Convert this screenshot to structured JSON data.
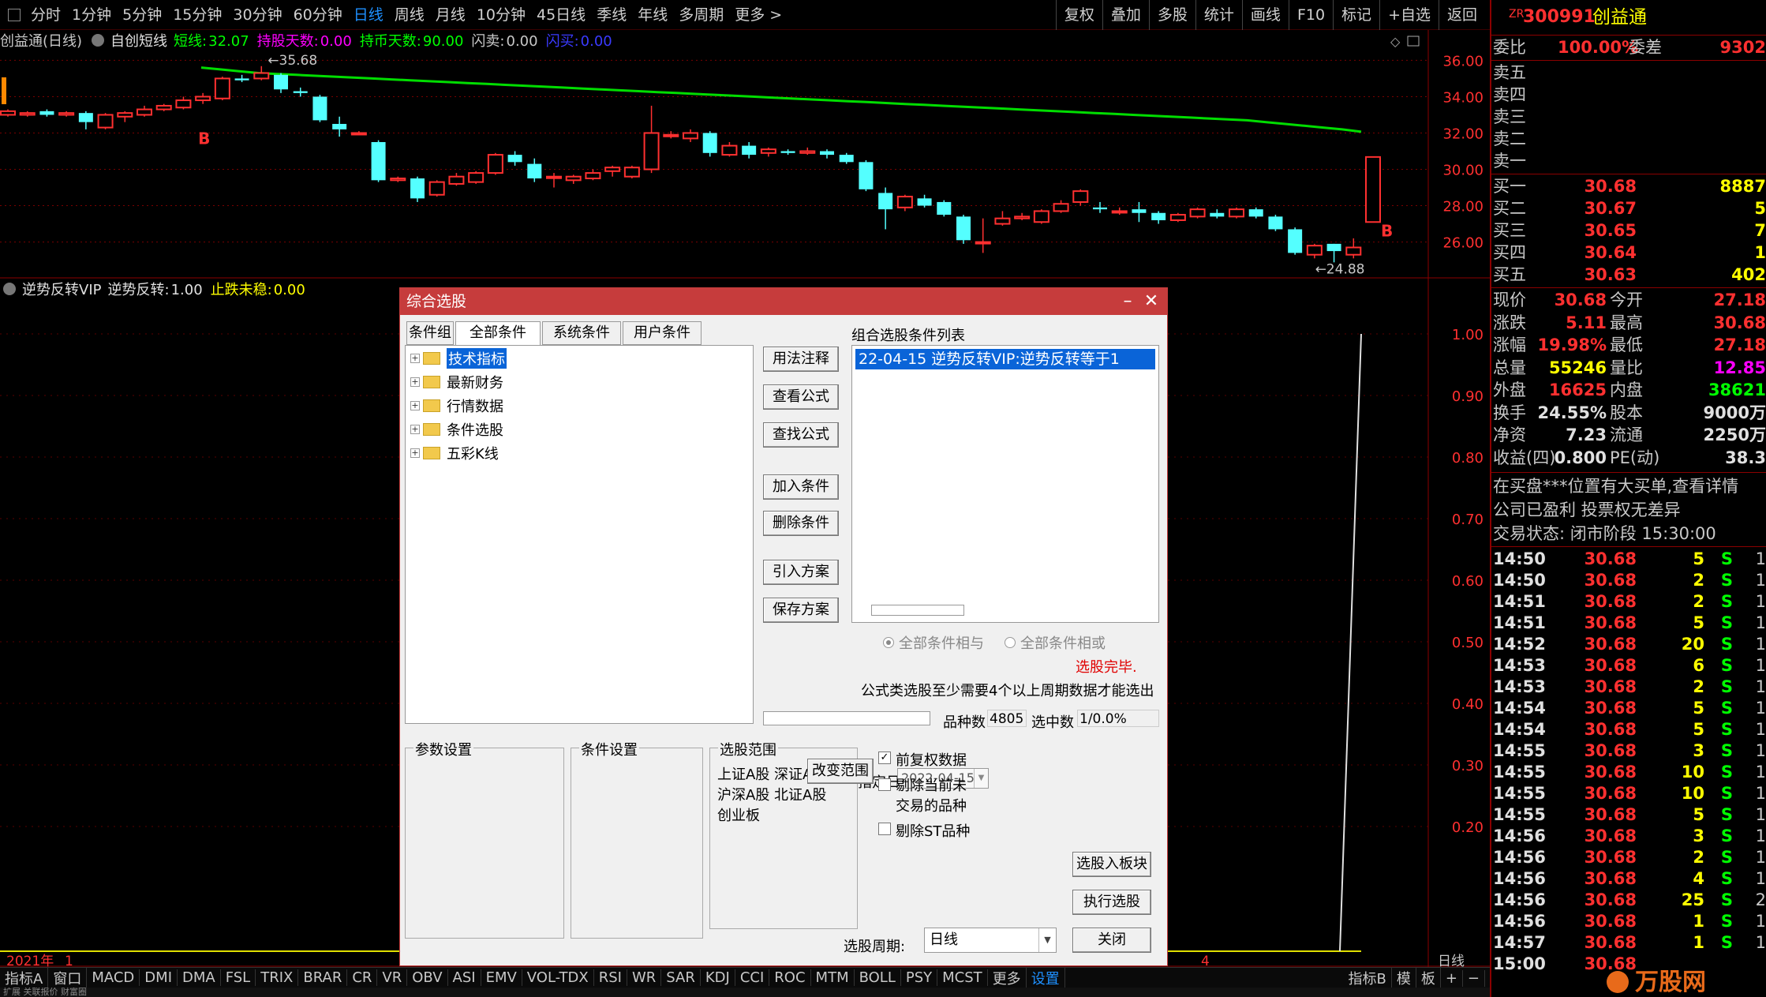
{
  "toolbar": {
    "left": [
      "分时",
      "1分钟",
      "5分钟",
      "15分钟",
      "30分钟",
      "60分钟",
      "日线",
      "周线",
      "月线",
      "10分钟",
      "45日线",
      "季线",
      "年线",
      "多周期",
      "更多 >"
    ],
    "active": "日线",
    "right": [
      "复权",
      "叠加",
      "多股",
      "统计",
      "画线",
      "F10",
      "标记",
      "+自选",
      "返回"
    ]
  },
  "kline_header": {
    "title": "创益通(日线)",
    "indicator": "自创短线",
    "items": [
      {
        "label": "短线:",
        "value": "32.07",
        "color": "#00ff00"
      },
      {
        "label": "持股天数:",
        "value": "0.00",
        "color": "#ff00ff"
      },
      {
        "label": "持币天数:",
        "value": "90.00",
        "color": "#00ff00"
      },
      {
        "label": "闪卖:",
        "value": "0.00",
        "color": "#c8c8c8"
      },
      {
        "label": "闪买:",
        "value": "0.00",
        "color": "#3a3aff"
      }
    ]
  },
  "indicator_header": {
    "name": "逆势反转VIP",
    "items": [
      {
        "label": "逆势反转:",
        "value": "1.00",
        "color": "#e0e0e0"
      },
      {
        "label": "止跌未稳:",
        "value": "0.00",
        "color": "#ffff00"
      }
    ]
  },
  "chart_data": {
    "type": "candlestick",
    "y_axis_ticks": [
      "36.00",
      "34.00",
      "32.00",
      "30.00",
      "28.00",
      "26.00"
    ],
    "ylim": [
      24.2,
      36.8
    ],
    "annotations": {
      "high_label": "35.68",
      "low_label": "24.88",
      "buy_marks": [
        "B",
        "B"
      ]
    },
    "ma_line_color": "#00dd00",
    "ma_values": [
      35.6,
      35.5,
      35.4,
      35.3,
      35.25,
      35.2,
      35.15,
      35.1,
      35.05,
      35.0,
      34.95,
      34.9,
      34.85,
      34.8,
      34.75,
      34.7,
      34.65,
      34.6,
      34.55,
      34.5,
      34.45,
      34.4,
      34.35,
      34.3,
      34.25,
      34.2,
      34.15,
      34.1,
      34.05,
      34.0,
      33.95,
      33.9,
      33.85,
      33.8,
      33.75,
      33.7,
      33.65,
      33.6,
      33.55,
      33.5,
      33.45,
      33.4,
      33.35,
      33.3,
      33.25,
      33.2,
      33.15,
      33.1,
      33.05,
      33.0,
      32.95,
      32.9,
      32.85,
      32.8,
      32.75,
      32.7,
      32.6,
      32.5,
      32.4,
      32.3,
      32.2,
      32.07
    ],
    "candles": [
      [
        33.0,
        33.2,
        33.3,
        32.9
      ],
      [
        33.0,
        33.1,
        33.2,
        32.9
      ],
      [
        33.2,
        33.0,
        33.3,
        32.9
      ],
      [
        33.0,
        33.1,
        33.2,
        32.9
      ],
      [
        33.1,
        32.6,
        33.2,
        32.2
      ],
      [
        32.3,
        33.0,
        33.1,
        32.2
      ],
      [
        32.9,
        33.1,
        33.2,
        32.6
      ],
      [
        33.0,
        33.3,
        33.5,
        32.9
      ],
      [
        33.3,
        33.5,
        33.6,
        33.2
      ],
      [
        33.4,
        33.8,
        34.0,
        33.3
      ],
      [
        33.8,
        34.0,
        34.2,
        33.6
      ],
      [
        33.9,
        35.0,
        35.1,
        33.8
      ],
      [
        35.0,
        34.9,
        35.2,
        34.8
      ],
      [
        35.0,
        35.3,
        35.68,
        34.9
      ],
      [
        35.2,
        34.4,
        35.3,
        34.2
      ],
      [
        34.3,
        34.2,
        34.5,
        34.0
      ],
      [
        34.0,
        32.7,
        34.1,
        32.6
      ],
      [
        32.5,
        32.2,
        32.9,
        31.8
      ],
      [
        32.0,
        32.0,
        32.1,
        31.9
      ],
      [
        31.5,
        29.4,
        31.6,
        29.3
      ],
      [
        29.4,
        29.5,
        29.6,
        29.3
      ],
      [
        29.5,
        28.4,
        29.6,
        28.2
      ],
      [
        28.6,
        29.3,
        29.4,
        28.5
      ],
      [
        29.2,
        29.6,
        29.8,
        29.1
      ],
      [
        29.3,
        29.8,
        29.9,
        29.2
      ],
      [
        29.8,
        30.8,
        30.9,
        29.7
      ],
      [
        30.8,
        30.4,
        31.0,
        30.2
      ],
      [
        30.3,
        29.5,
        30.6,
        29.3
      ],
      [
        29.6,
        29.6,
        29.8,
        29.0
      ],
      [
        29.4,
        29.6,
        29.7,
        29.2
      ],
      [
        29.5,
        29.8,
        30.0,
        29.4
      ],
      [
        29.9,
        30.1,
        30.2,
        29.6
      ],
      [
        29.6,
        30.1,
        30.2,
        29.5
      ],
      [
        30.0,
        32.0,
        33.5,
        29.8
      ],
      [
        31.9,
        31.9,
        32.1,
        31.7
      ],
      [
        31.7,
        32.0,
        32.2,
        31.5
      ],
      [
        32.0,
        30.9,
        32.1,
        30.7
      ],
      [
        30.8,
        31.3,
        31.5,
        30.7
      ],
      [
        31.3,
        30.8,
        31.5,
        30.6
      ],
      [
        30.9,
        31.1,
        31.2,
        30.7
      ],
      [
        31.0,
        30.9,
        31.1,
        30.8
      ],
      [
        30.9,
        31.0,
        31.2,
        30.8
      ],
      [
        31.0,
        30.8,
        31.1,
        30.6
      ],
      [
        30.8,
        30.4,
        30.9,
        30.3
      ],
      [
        30.4,
        28.9,
        30.5,
        28.8
      ],
      [
        28.7,
        27.8,
        29.0,
        26.7
      ],
      [
        27.9,
        28.5,
        28.6,
        27.7
      ],
      [
        28.4,
        28.0,
        28.6,
        27.9
      ],
      [
        28.2,
        27.5,
        28.3,
        27.4
      ],
      [
        27.4,
        26.1,
        27.5,
        25.9
      ],
      [
        26.0,
        26.0,
        27.3,
        25.4
      ],
      [
        27.0,
        27.3,
        27.7,
        26.9
      ],
      [
        27.3,
        27.4,
        27.6,
        27.2
      ],
      [
        27.1,
        27.7,
        27.8,
        27.0
      ],
      [
        27.7,
        28.1,
        28.3,
        27.6
      ],
      [
        28.2,
        28.8,
        28.9,
        28.0
      ],
      [
        27.9,
        27.8,
        28.2,
        27.6
      ],
      [
        27.7,
        27.7,
        27.9,
        27.5
      ],
      [
        27.8,
        27.6,
        28.2,
        27.1
      ],
      [
        27.6,
        27.2,
        27.7,
        27.0
      ],
      [
        27.2,
        27.5,
        27.6,
        27.1
      ],
      [
        27.4,
        27.8,
        27.9,
        27.3
      ],
      [
        27.6,
        27.4,
        27.8,
        27.3
      ],
      [
        27.4,
        27.8,
        27.9,
        27.3
      ],
      [
        27.8,
        27.4,
        27.9,
        27.3
      ],
      [
        27.4,
        26.7,
        27.5,
        26.6
      ],
      [
        26.7,
        25.4,
        26.8,
        25.3
      ],
      [
        25.3,
        25.8,
        25.9,
        25.1
      ],
      [
        25.9,
        25.5,
        25.9,
        24.88
      ],
      [
        25.3,
        25.7,
        26.2,
        25.1
      ],
      [
        27.1,
        30.68,
        30.68,
        27.18
      ]
    ],
    "indicator_ticks": [
      "1.00",
      "0.90",
      "0.80",
      "0.70",
      "0.60",
      "0.50",
      "0.40",
      "0.30",
      "0.20"
    ],
    "indicator_final_value": 1.0,
    "x_labels": [
      "2021年",
      "1",
      "4"
    ],
    "x_period_label": "日线"
  },
  "bottom_tabs": [
    "指标A",
    "窗口",
    "MACD",
    "DMI",
    "DMA",
    "FSL",
    "TRIX",
    "BRAR",
    "CR",
    "VR",
    "OBV",
    "ASI",
    "EMV",
    "VOL-TDX",
    "RSI",
    "WR",
    "SAR",
    "KDJ",
    "CCI",
    "ROC",
    "MTM",
    "BOLL",
    "PSY",
    "MCST",
    "更多",
    "设置"
  ],
  "bottom_right_tabs": [
    "指标B",
    "模",
    "板",
    "+",
    "−"
  ],
  "status_bar": "扩展  关联报价  财富圈",
  "quote": {
    "prefix": "ZR",
    "code": "300991",
    "name": "创益通",
    "weibi_label": "委比",
    "weibi": "100.00%",
    "weicha_label": "委差",
    "weicha": "9302",
    "asks": [
      {
        "l": "卖五"
      },
      {
        "l": "卖四"
      },
      {
        "l": "卖三"
      },
      {
        "l": "卖二"
      },
      {
        "l": "卖一"
      }
    ],
    "bids": [
      {
        "l": "买一",
        "p": "30.68",
        "v": "8887"
      },
      {
        "l": "买二",
        "p": "30.67",
        "v": "5"
      },
      {
        "l": "买三",
        "p": "30.65",
        "v": "7"
      },
      {
        "l": "买四",
        "p": "30.64",
        "v": "1"
      },
      {
        "l": "买五",
        "p": "30.63",
        "v": "402"
      }
    ],
    "stats": [
      {
        "l1": "现价",
        "v1": "30.68",
        "c1": "#ff3030",
        "l2": "今开",
        "v2": "27.18",
        "c2": "#ff3030"
      },
      {
        "l1": "涨跌",
        "v1": "5.11",
        "c1": "#ff3030",
        "l2": "最高",
        "v2": "30.68",
        "c2": "#ff3030"
      },
      {
        "l1": "涨幅",
        "v1": "19.98%",
        "c1": "#ff3030",
        "l2": "最低",
        "v2": "27.18",
        "c2": "#ff3030"
      },
      {
        "l1": "总量",
        "v1": "55246",
        "c1": "#ffff00",
        "l2": "量比",
        "v2": "12.85",
        "c2": "#ff00ff"
      },
      {
        "l1": "外盘",
        "v1": "16625",
        "c1": "#ff3030",
        "l2": "内盘",
        "v2": "38621",
        "c2": "#00ff00"
      },
      {
        "l1": "换手",
        "v1": "24.55%",
        "c1": "#e0e0e0",
        "l2": "股本",
        "v2": "9000万",
        "c2": "#e0e0e0"
      },
      {
        "l1": "净资",
        "v1": "7.23",
        "c1": "#e0e0e0",
        "l2": "流通",
        "v2": "2250万",
        "c2": "#e0e0e0"
      },
      {
        "l1": "收益(四)",
        "v1": "0.800",
        "c1": "#e0e0e0",
        "l2": "PE(动)",
        "v2": "38.3",
        "c2": "#e0e0e0"
      }
    ],
    "news1": "在买盘***位置有大买单,查看详情",
    "news2": "公司已盈利 投票权无差异",
    "trade_status": "交易状态: 闭市阶段 15:30:00",
    "ticks": [
      {
        "t": "14:50",
        "p": "30.68",
        "v": "5",
        "s": "S",
        "n": "1"
      },
      {
        "t": "14:50",
        "p": "30.68",
        "v": "2",
        "s": "S",
        "n": "1"
      },
      {
        "t": "14:51",
        "p": "30.68",
        "v": "2",
        "s": "S",
        "n": "1"
      },
      {
        "t": "14:51",
        "p": "30.68",
        "v": "5",
        "s": "S",
        "n": "1"
      },
      {
        "t": "14:52",
        "p": "30.68",
        "v": "20",
        "s": "S",
        "n": "1"
      },
      {
        "t": "14:53",
        "p": "30.68",
        "v": "6",
        "s": "S",
        "n": "1"
      },
      {
        "t": "14:53",
        "p": "30.68",
        "v": "2",
        "s": "S",
        "n": "1"
      },
      {
        "t": "14:54",
        "p": "30.68",
        "v": "5",
        "s": "S",
        "n": "1"
      },
      {
        "t": "14:54",
        "p": "30.68",
        "v": "5",
        "s": "S",
        "n": "1"
      },
      {
        "t": "14:55",
        "p": "30.68",
        "v": "3",
        "s": "S",
        "n": "1"
      },
      {
        "t": "14:55",
        "p": "30.68",
        "v": "10",
        "s": "S",
        "n": "1"
      },
      {
        "t": "14:55",
        "p": "30.68",
        "v": "10",
        "s": "S",
        "n": "1"
      },
      {
        "t": "14:55",
        "p": "30.68",
        "v": "5",
        "s": "S",
        "n": "1"
      },
      {
        "t": "14:56",
        "p": "30.68",
        "v": "3",
        "s": "S",
        "n": "1"
      },
      {
        "t": "14:56",
        "p": "30.68",
        "v": "2",
        "s": "S",
        "n": "1"
      },
      {
        "t": "14:56",
        "p": "30.68",
        "v": "4",
        "s": "S",
        "n": "1"
      },
      {
        "t": "14:56",
        "p": "30.68",
        "v": "25",
        "s": "S",
        "n": "2"
      },
      {
        "t": "14:56",
        "p": "30.68",
        "v": "1",
        "s": "S",
        "n": "1"
      },
      {
        "t": "14:57",
        "p": "30.68",
        "v": "1",
        "s": "S",
        "n": "1"
      },
      {
        "t": "15:00",
        "p": "30.68",
        "v": "",
        "s": "",
        "n": ""
      }
    ]
  },
  "dialog": {
    "title": "综合选股",
    "tabs": [
      "条件组",
      "全部条件",
      "系统条件",
      "用户条件"
    ],
    "active_tab": "全部条件",
    "tree": [
      "技术指标",
      "最新财务",
      "行情数据",
      "条件选股",
      "五彩K线"
    ],
    "buttons": [
      "用法注释",
      "查看公式",
      "查找公式",
      "加入条件",
      "删除条件",
      "引入方案",
      "保存方案"
    ],
    "cond_list_label": "组合选股条件列表",
    "cond_items": [
      "22-04-15 逆势反转VIP:逆势反转等于1"
    ],
    "radio_and": "全部条件相与",
    "radio_or": "全部条件相或",
    "done": "选股完毕.",
    "note": "公式类选股至少需要4个以上周期数据才能选出",
    "count_label": "品种数",
    "count_value": "4805",
    "selected_label": "选中数",
    "selected_value": "1/0.0%",
    "params_title": "参数设置",
    "cond_settings_title": "条件设置",
    "date_label": "指定日期:",
    "date_value": "2022-04-15",
    "range_title": "选股范围",
    "range_items": [
      "上证A股 深证A股",
      "沪深A股 北证A股",
      "创业板"
    ],
    "change_range": "改变范围",
    "opt_adjust": "前复权数据",
    "opt_exclude_untradable": "剔除当前未交易的品种",
    "opt_exclude_st": "剔除ST品种",
    "to_block": "选股入板块",
    "execute": "执行选股",
    "period_label": "选股周期:",
    "period_value": "日线",
    "close": "关闭"
  },
  "watermark": "万股网"
}
